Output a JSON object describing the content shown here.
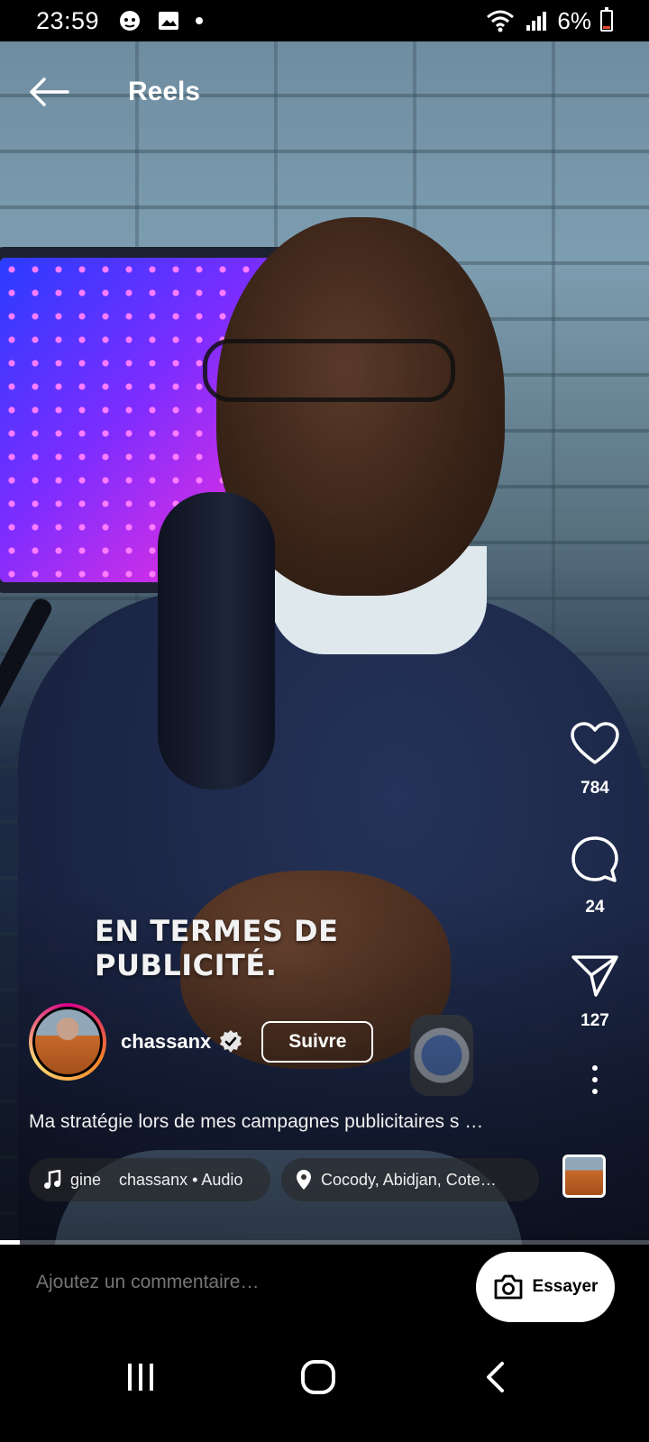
{
  "status_bar": {
    "time": "23:59",
    "battery": "6%",
    "icons": [
      "face-notification-icon",
      "image-notification-icon",
      "dot-icon",
      "wifi-icon",
      "signal-icon",
      "battery-icon"
    ]
  },
  "header": {
    "title": "Reels"
  },
  "video": {
    "caption": [
      "EN TERMES DE",
      "PUBLICITÉ."
    ],
    "progress": 0.03
  },
  "actions": {
    "likes": "784",
    "comments": "24",
    "shares": "127"
  },
  "author": {
    "username": "chassanx",
    "follow_label": "Suivre"
  },
  "post": {
    "description": "Ma stratégie lors de mes campagnes publicitaires s …",
    "audio": "gine    chassanx • Audio",
    "location": "Cocody, Abidjan, Cote…"
  },
  "comment_bar": {
    "placeholder": "Ajoutez un commentaire…",
    "try_label": "Essayer"
  },
  "colors": {
    "accent_ring": "#d4008a",
    "background": "#000000",
    "battery_low": "#e24a2b"
  }
}
